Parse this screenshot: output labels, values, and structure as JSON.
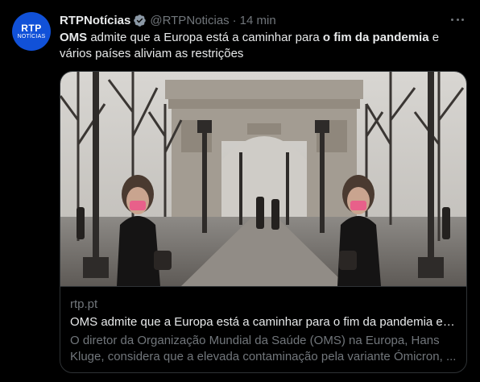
{
  "author": {
    "avatar_logo": "RTP",
    "avatar_subtext": "NOTÍCIAS",
    "display_name": "RTPNotícias",
    "handle": "@RTPNoticias",
    "separator": "·",
    "time": "14 min",
    "verified_icon": "verified-badge-icon"
  },
  "tweet": {
    "text_bold_1": "OMS",
    "text_1": " admite que a Europa está a caminhar para ",
    "text_bold_2": "o fim da pandemia",
    "text_2": " e vários países aliviam as restrições"
  },
  "card": {
    "image_description_icon": "arc-de-triomphe-photo",
    "domain": "rtp.pt",
    "title": "OMS admite que a Europa está a caminhar para o fim da pandemia e v...",
    "description": "O diretor da Organização Mundial da Saúde (OMS) na Europa, Hans Kluge, considera que a elevada contaminação pela variante Ómicron, ..."
  },
  "colors": {
    "background": "#000000",
    "text_primary": "#e7e9ea",
    "text_secondary": "#71767b",
    "border": "#2f3336",
    "verified": "#8b98a5",
    "avatar_bg": "#1151d8",
    "mask_pink": "#e8608a"
  }
}
